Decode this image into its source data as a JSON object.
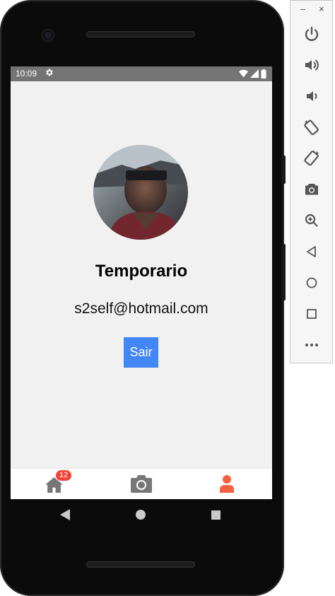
{
  "status_bar": {
    "time": "10:09"
  },
  "profile": {
    "name": "Temporario",
    "email": "s2self@hotmail.com",
    "logout_label": "Sair"
  },
  "tab_bar": {
    "home_badge": "12"
  },
  "colors": {
    "accent_button": "#4287f5",
    "active_tab": "#f4613f",
    "badge": "#f44336",
    "inactive_tab": "#777777"
  },
  "emulator_panel": {
    "minimize_label": "–",
    "close_label": "×",
    "buttons": [
      "power-icon",
      "volume-up-icon",
      "volume-down-icon",
      "rotate-left-icon",
      "rotate-right-icon",
      "screenshot-icon",
      "zoom-icon",
      "back-icon",
      "home-icon",
      "overview-icon",
      "more-icon"
    ]
  }
}
